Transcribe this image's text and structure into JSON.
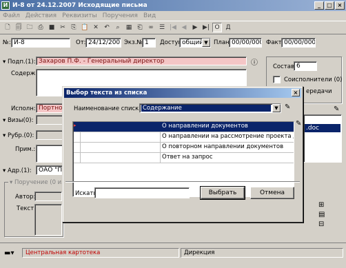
{
  "window": {
    "title": "И-8 от 24.12.2007 Исходящие письма"
  },
  "menu": [
    "Файл",
    "Действия",
    "Реквизиты",
    "Поручения",
    "Вид"
  ],
  "toolbar": {
    "od_label": "О",
    "d_label": "Д"
  },
  "header": {
    "num_label": "№:",
    "num_value": "И-8",
    "from_label": "От:",
    "from_value": "24/12/2007",
    "copies_label": "Экз.№:",
    "copies_value": "1",
    "access_label": "Доступ:",
    "access_value": "общий",
    "plan_label": "План:",
    "plan_value": "00/00/0000",
    "fact_label": "Факт:",
    "fact_value": "00/00/0000"
  },
  "form": {
    "signers_label": "Подп.(1):",
    "signers_value": "Захаров П.Ф. - Генеральный директор",
    "content_label": "Содерж.:",
    "executor_label": "Исполн:",
    "executor_value": "Портнов",
    "visas_label": "Визы(0):",
    "rubrics_label": "Рубр.(0):",
    "notes_label": "Прим.:",
    "addressees_label": "Адр.(1):",
    "addressees_value": "ОАО \"Пр",
    "assignment_label": "Поручение (0 из 0)",
    "author_label": "Автор:",
    "text_label": "Текст:"
  },
  "right_panel": {
    "composition_label": "Состав:",
    "composition_value": "6",
    "coexecutors_label": "Соисполнители (0)",
    "transfer_label": "ередачи",
    "file_label": ".doc"
  },
  "status": {
    "left": "Центральная картотека",
    "right": "Дирекция"
  },
  "dialog": {
    "title": "Выбор текста из списка",
    "list_name_label": "Наименование списка:",
    "list_name_value": "Содержание",
    "rows": [
      {
        "text": "О направлении документов",
        "selected": true
      },
      {
        "text": "О направлении на рассмотрение проекта догово",
        "selected": false
      },
      {
        "text": "О повторном направлении документов",
        "selected": false
      },
      {
        "text": "Ответ на запрос",
        "selected": false
      }
    ],
    "search_label": "Искать:",
    "search_value": "",
    "ok_label": "Выбрать",
    "cancel_label": "Отмена"
  },
  "colors": {
    "title_blue": "#0a246a",
    "pink_field": "#f4c6c6",
    "status_red": "#c00000"
  }
}
